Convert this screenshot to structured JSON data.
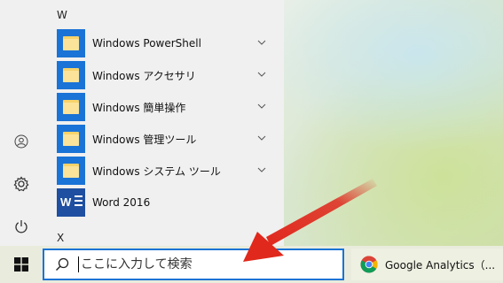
{
  "start_menu": {
    "sections": [
      {
        "letter": "W"
      },
      {
        "letter": "X"
      }
    ],
    "apps": [
      {
        "label": "Windows PowerShell",
        "icon": "folder-icon",
        "expandable": true
      },
      {
        "label": "Windows アクセサリ",
        "icon": "folder-icon",
        "expandable": true
      },
      {
        "label": "Windows 簡単操作",
        "icon": "folder-icon",
        "expandable": true
      },
      {
        "label": "Windows 管理ツール",
        "icon": "folder-icon",
        "expandable": true
      },
      {
        "label": "Windows システム ツール",
        "icon": "folder-icon",
        "expandable": true
      },
      {
        "label": "Word 2016",
        "icon": "word-icon",
        "expandable": false
      }
    ],
    "rail": [
      "user-icon",
      "settings-gear-icon",
      "power-icon"
    ]
  },
  "taskbar": {
    "search": {
      "placeholder": "ここに入力して検索"
    },
    "task": {
      "label": "Google Analytics（...",
      "icon": "chrome-icon"
    }
  },
  "colors": {
    "accent": "#1a73d6",
    "folder": "#f6d36a",
    "arrow": "#e0281c"
  }
}
